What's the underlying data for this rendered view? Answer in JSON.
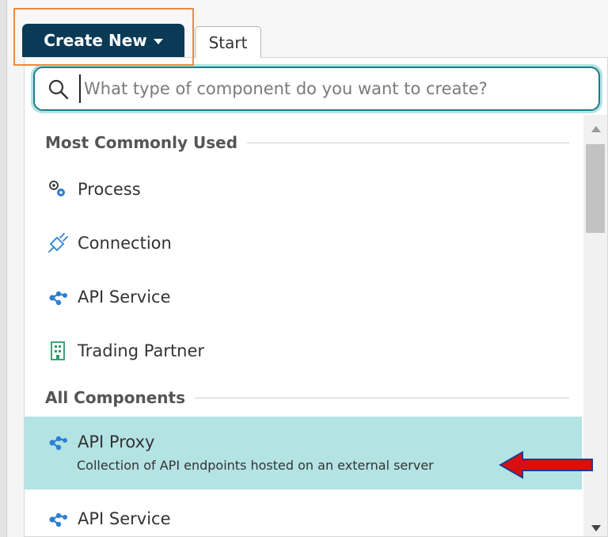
{
  "toolbar": {
    "create_new_label": "Create New",
    "start_tab_label": "Start"
  },
  "search": {
    "placeholder": "What type of component do you want to create?",
    "value": ""
  },
  "sections": {
    "common": {
      "header": "Most Commonly Used",
      "items": [
        {
          "label": "Process",
          "icon": "process-gears-icon"
        },
        {
          "label": "Connection",
          "icon": "plug-icon"
        },
        {
          "label": "API Service",
          "icon": "api-nodes-icon"
        },
        {
          "label": "Trading Partner",
          "icon": "building-icon"
        }
      ]
    },
    "all": {
      "header": "All Components",
      "items": [
        {
          "label": "API Proxy",
          "description": "Collection of API endpoints hosted on an external server",
          "icon": "api-nodes-icon",
          "selected": true
        },
        {
          "label": "API Service",
          "icon": "api-nodes-icon"
        }
      ]
    }
  },
  "colors": {
    "create_button_bg": "#0b3a57",
    "highlight": "#b4e3e4",
    "search_border": "#1b7d8a",
    "icon_blue": "#2f7fd1",
    "icon_green": "#2e9a6a",
    "annotation_orange": "#f0883e",
    "annotation_arrow": "#d80f0f"
  }
}
